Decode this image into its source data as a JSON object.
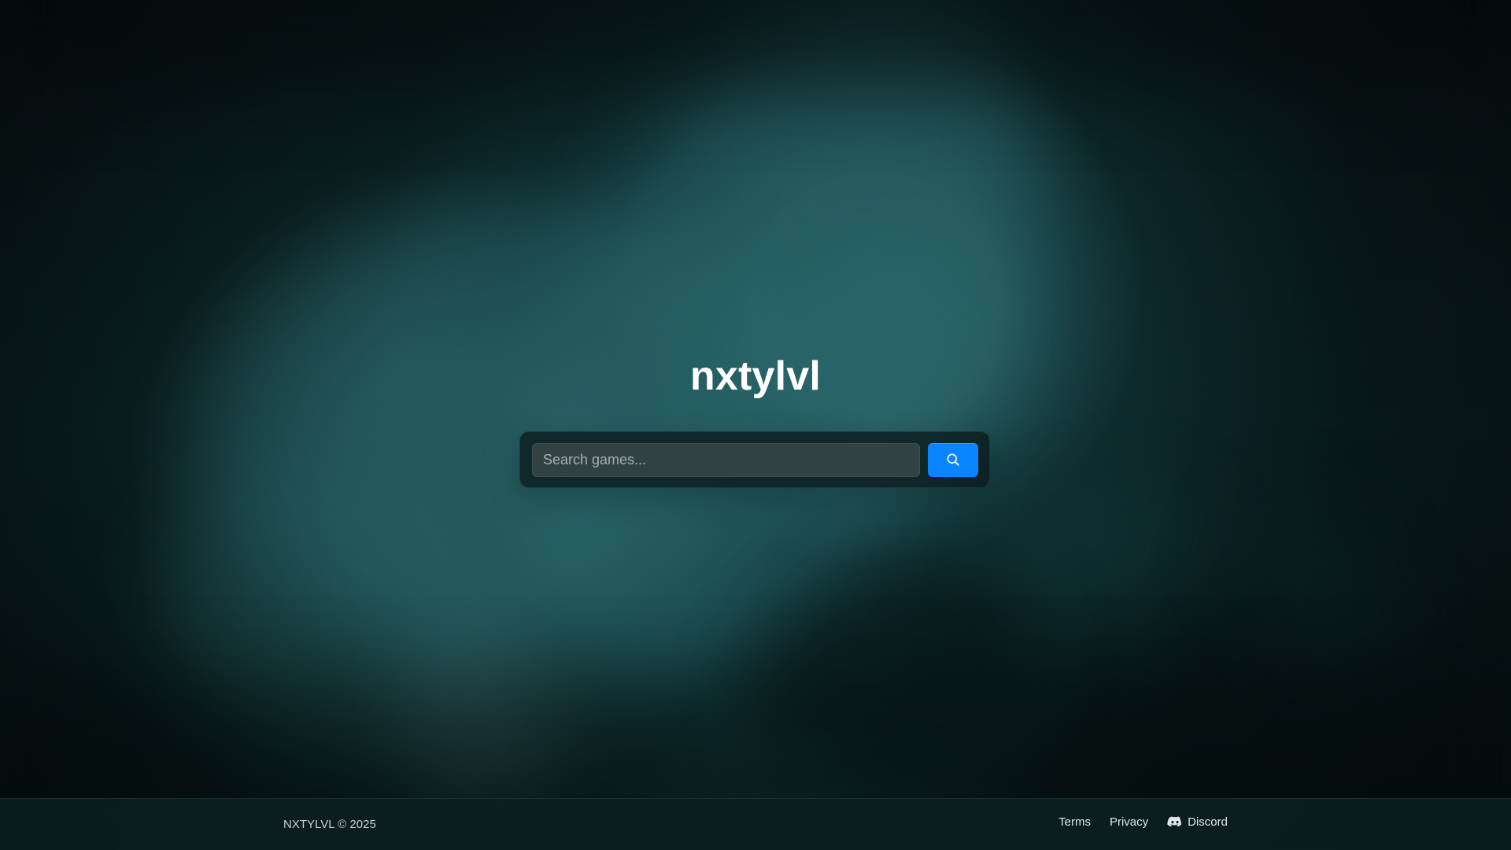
{
  "brand": {
    "title": "nxtylvl"
  },
  "search": {
    "placeholder": "Search games...",
    "button_icon": "search-icon"
  },
  "footer": {
    "copyright": "NXTYLVL © 2025",
    "links": [
      {
        "label": "Terms"
      },
      {
        "label": "Privacy"
      },
      {
        "label": "Discord",
        "icon": "discord-icon"
      }
    ]
  },
  "colors": {
    "accent": "#0a84ff",
    "background": "#071314",
    "panel": "#0c1a1c"
  }
}
